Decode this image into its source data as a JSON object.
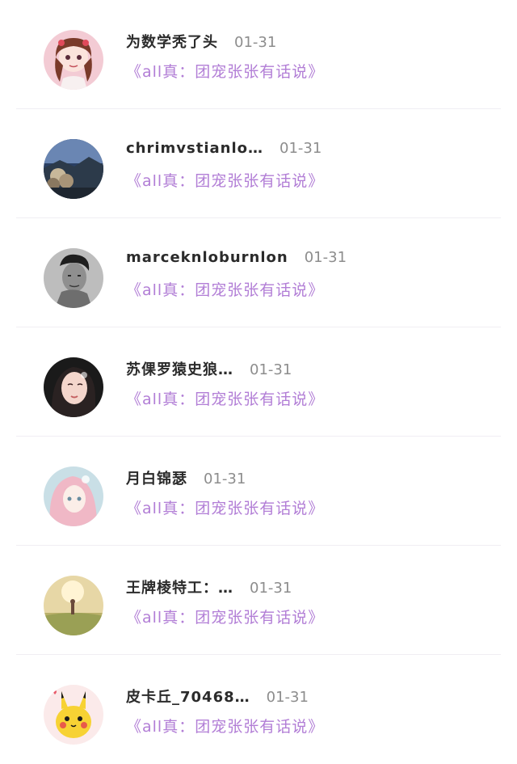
{
  "messages": [
    {
      "name": "为数学秃了头",
      "date": "01-31",
      "preview": "《all真：团宠张张有话说》",
      "avatar": "anime-girl-avatar"
    },
    {
      "name": "chrimvstianlo…",
      "date": "01-31",
      "preview": "《all真：团宠张张有话说》",
      "avatar": "landscape-avatar"
    },
    {
      "name": "marceknloburnlon",
      "date": "01-31",
      "preview": "《all真：团宠张张有话说》",
      "avatar": "man-portrait-avatar"
    },
    {
      "name": "苏倮罗猿史狼…",
      "date": "01-31",
      "preview": "《all真：团宠张张有话说》",
      "avatar": "woman-portrait-avatar"
    },
    {
      "name": "月白锦瑟",
      "date": "01-31",
      "preview": "《all真：团宠张张有话说》",
      "avatar": "anime-pink-hair-avatar"
    },
    {
      "name": "王牌棱特工：…",
      "date": "01-31",
      "preview": "《all真：团宠张张有话说》",
      "avatar": "sunset-field-avatar"
    },
    {
      "name": "皮卡丘_70468…",
      "date": "01-31",
      "preview": "《all真：团宠张张有话说》",
      "avatar": "pikachu-avatar"
    }
  ],
  "colors": {
    "name": "#2b2b2b",
    "date": "#8d8d8d",
    "preview": "#b27ed6",
    "divider": "#f0eef3"
  }
}
